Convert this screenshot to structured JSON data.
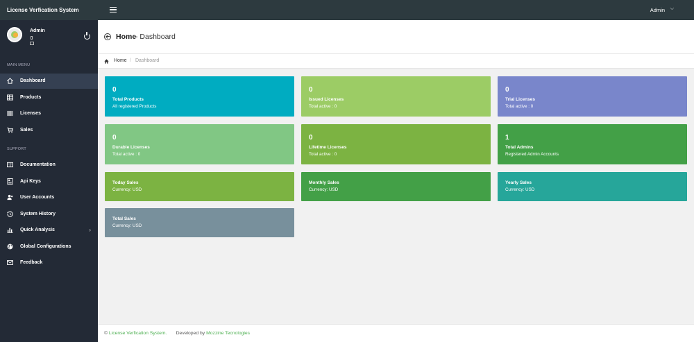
{
  "topbar": {
    "brand": "License Verfication System",
    "admin": "Admin",
    "caret": "⌵"
  },
  "sidebar": {
    "profile_name": "Admin",
    "main_menu_label": "MAIN MENU",
    "support_label": "SUPPORT",
    "main_items": [
      {
        "label": "Dashboard",
        "icon": "home-icon",
        "active": true
      },
      {
        "label": "Products",
        "icon": "grid-icon"
      },
      {
        "label": "Licenses",
        "icon": "barcode-icon"
      },
      {
        "label": "Sales",
        "icon": "cart-icon"
      }
    ],
    "support_items": [
      {
        "label": "Documentation",
        "icon": "book-icon"
      },
      {
        "label": "Api Keys",
        "icon": "key-card-icon"
      },
      {
        "label": "User Accounts",
        "icon": "users-icon"
      },
      {
        "label": "System History",
        "icon": "history-icon"
      },
      {
        "label": "Quick Analysis",
        "icon": "chart-icon",
        "chevron": "›"
      },
      {
        "label": "Global Configurations",
        "icon": "globe-icon"
      },
      {
        "label": "Feedback",
        "icon": "mail-icon"
      }
    ]
  },
  "header": {
    "title": "Home",
    "subtitle": "- Dashboard"
  },
  "breadcrumb": {
    "home": "Home",
    "separator": "/",
    "current": "Dashboard"
  },
  "cards_row1": [
    {
      "count": "0",
      "label": "Total Products",
      "sub": "All registered Products",
      "color": "#00acc1"
    },
    {
      "count": "0",
      "label": "Issued Licenses",
      "sub": "Total active : 0",
      "color": "#9ccc65"
    },
    {
      "count": "0",
      "label": "Trial Licenses",
      "sub": "Total active : 0",
      "color": "#7986cb"
    }
  ],
  "cards_row2": [
    {
      "count": "0",
      "label": "Durable Licenses",
      "sub": "Total active : 0",
      "color": "#81c784"
    },
    {
      "count": "0",
      "label": "Lifetime Licenses",
      "sub": "Total active : 0",
      "color": "#7cb342"
    },
    {
      "count": "1",
      "label": "Total Admins",
      "sub": "Registered Admin Accounts",
      "color": "#43a047"
    }
  ],
  "cards_row3": [
    {
      "label": "Today Sales",
      "sub": "Currency: USD",
      "color": "#7cb342"
    },
    {
      "label": "Monthly Sales",
      "sub": "Currency: USD",
      "color": "#43a047"
    },
    {
      "label": "Yearly Sales",
      "sub": "Currency: USD",
      "color": "#26a69a"
    }
  ],
  "cards_row4": [
    {
      "label": "Total Sales",
      "sub": "Currency: USD",
      "color": "#78909c"
    }
  ],
  "footer": {
    "copyright": "©",
    "system_link": "License Verfication System.",
    "developed_by": "Developed by",
    "dev_link": "Mozzine Tecnologies"
  }
}
